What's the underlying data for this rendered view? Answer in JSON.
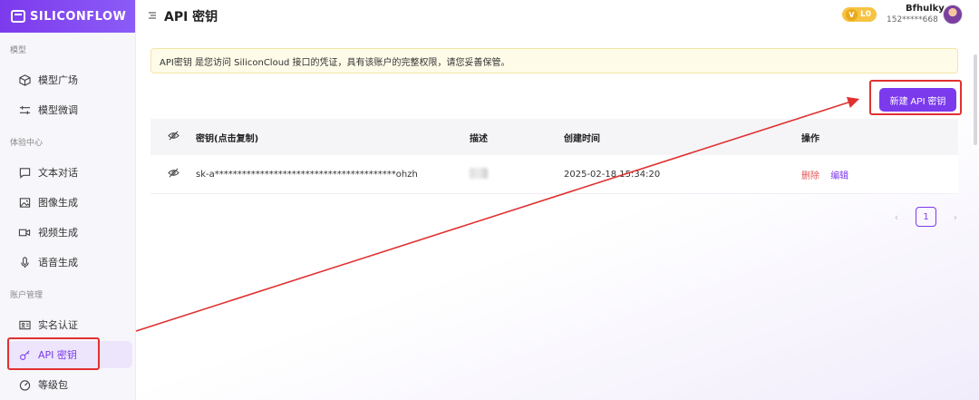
{
  "app": {
    "brand": "SILICONFLOW"
  },
  "sidebar": {
    "sections": [
      {
        "title": "模型",
        "items": [
          {
            "label": "模型广场",
            "icon": "cube-icon"
          },
          {
            "label": "模型微调",
            "icon": "sliders-icon"
          }
        ]
      },
      {
        "title": "体验中心",
        "items": [
          {
            "label": "文本对话",
            "icon": "chat-icon"
          },
          {
            "label": "图像生成",
            "icon": "image-icon"
          },
          {
            "label": "视频生成",
            "icon": "video-icon"
          },
          {
            "label": "语音生成",
            "icon": "mic-icon"
          }
        ]
      },
      {
        "title": "账户管理",
        "items": [
          {
            "label": "实名认证",
            "icon": "id-card-icon"
          },
          {
            "label": "API 密钥",
            "icon": "key-icon",
            "active": true
          },
          {
            "label": "等级包",
            "icon": "gauge-icon"
          }
        ]
      }
    ]
  },
  "header": {
    "title": "API 密钥",
    "level_badge": "L0",
    "level_badge_v": "V",
    "user_name": "Bfhulky",
    "user_phone": "152*****668"
  },
  "notice": "API密钥 是您访问 SiliconCloud 接口的凭证，具有该账户的完整权限，请您妥善保管。",
  "actions": {
    "new_key_button": "新建 API 密钥"
  },
  "table": {
    "headers": {
      "key": "密钥(点击复制)",
      "desc": "描述",
      "time": "创建时间",
      "ops": "操作"
    },
    "rows": [
      {
        "key": "sk-a****************************************ohzh",
        "desc": "",
        "created": "2025-02-18 15:34:20",
        "delete": "删除",
        "edit": "编辑"
      }
    ]
  },
  "pagination": {
    "current": "1",
    "prev": "‹",
    "next": "›"
  },
  "colors": {
    "accent": "#7c3aed",
    "highlight": "#e03131"
  }
}
